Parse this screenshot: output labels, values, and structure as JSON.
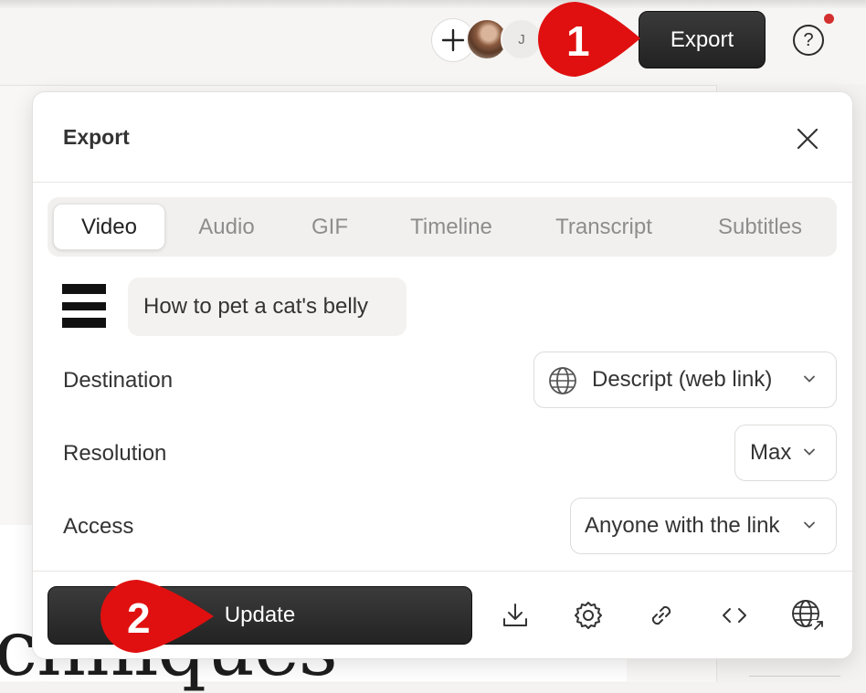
{
  "background": {
    "heading_fragment": "chniques"
  },
  "topbar": {
    "avatar_initial": "J",
    "export_label": "Export",
    "help_symbol": "?"
  },
  "annotations": {
    "step1": "1",
    "step2": "2",
    "color": "#e01010"
  },
  "dialog": {
    "title": "Export",
    "tabs": [
      {
        "label": "Video",
        "active": true
      },
      {
        "label": "Audio",
        "active": false
      },
      {
        "label": "GIF",
        "active": false
      },
      {
        "label": "Timeline",
        "active": false
      },
      {
        "label": "Transcript",
        "active": false
      },
      {
        "label": "Subtitles",
        "active": false
      }
    ],
    "composition_title": "How to pet a cat's belly",
    "destination": {
      "label": "Destination",
      "value": "Descript (web link)",
      "icon": "globe-icon"
    },
    "resolution": {
      "label": "Resolution",
      "value": "Max"
    },
    "access": {
      "label": "Access",
      "value": "Anyone with the link"
    },
    "update_label": "Update",
    "footer_icons": [
      "download-icon",
      "settings-gear-icon",
      "link-icon",
      "embed-code-icon",
      "publish-globe-icon"
    ]
  },
  "colors": {
    "primary_button": "#2a2a2a",
    "notification_dot": "#d32f2f",
    "annotation": "#e01010"
  }
}
